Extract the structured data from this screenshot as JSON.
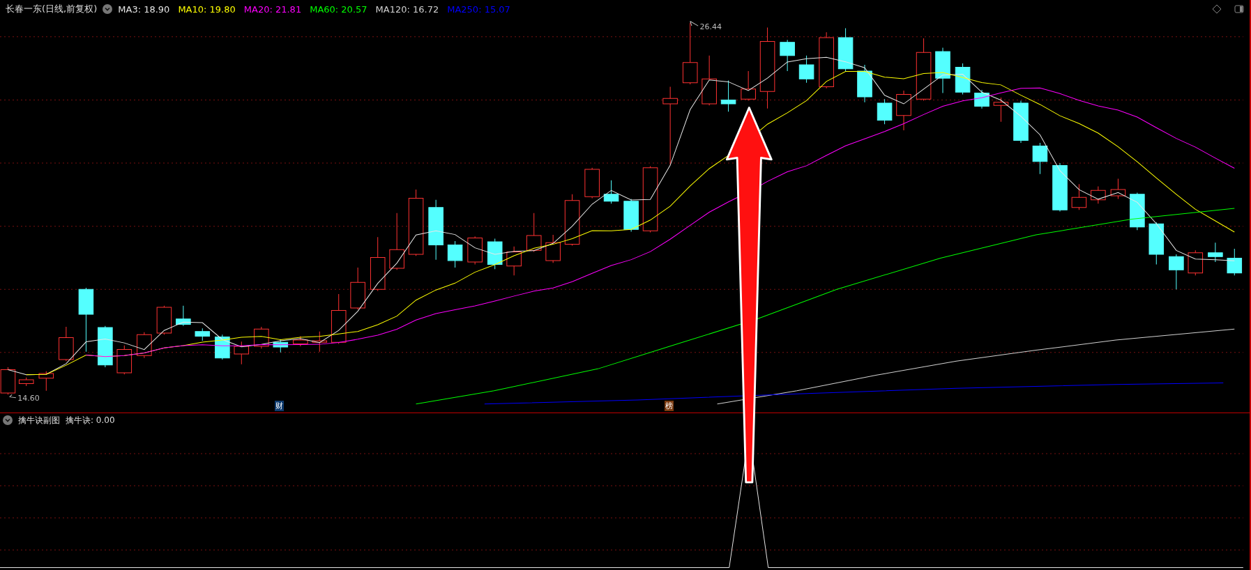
{
  "header": {
    "title": "长春一东(日线,前复权)",
    "indicators": [
      {
        "label": "MA3: 18.90",
        "color": "#e6e6e6"
      },
      {
        "label": "MA10: 19.80",
        "color": "#ffff00"
      },
      {
        "label": "MA20: 21.81",
        "color": "#ff00ff"
      },
      {
        "label": "MA60: 20.57",
        "color": "#00ff00"
      },
      {
        "label": "MA120: 16.72",
        "color": "#d0d0d0"
      },
      {
        "label": "MA250: 15.07",
        "color": "#0000ff"
      }
    ]
  },
  "main_chart": {
    "high_label": "26.44",
    "low_label": "14.60",
    "markers": [
      {
        "text": "财",
        "kind": "finance"
      },
      {
        "text": "榜",
        "kind": "ranking"
      }
    ]
  },
  "sub_chart": {
    "title": "擒牛诀副图",
    "reading": "擒牛诀: 0.00"
  }
}
